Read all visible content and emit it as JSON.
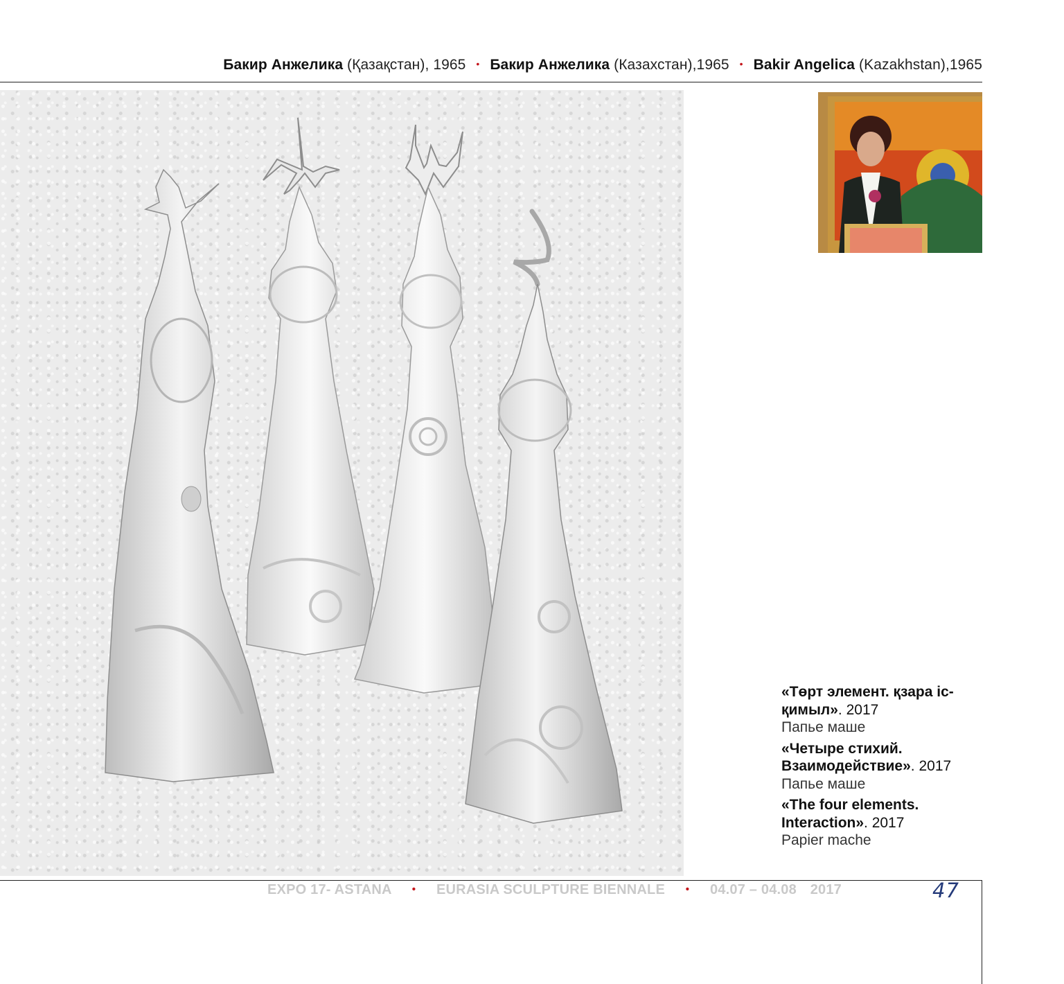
{
  "header": {
    "artist_kk_name": "Бакир Анжелика",
    "artist_kk_meta": "(Қазақстан), 1965",
    "artist_ru_name": "Бакир Анжелика",
    "artist_ru_meta": "(Казахстан),1965",
    "artist_en_name": "Bakir Angelica",
    "artist_en_meta": "(Kazakhstan),1965",
    "separator": "•"
  },
  "captions": [
    {
      "title": "«Төрт элемент. қзара іс-қимыл»",
      "year": "2017",
      "material": "Папье маше"
    },
    {
      "title": "«Четыре стихий. Взаимодействие»",
      "year": "2017",
      "material": "Папье маше"
    },
    {
      "title": "«The four elements. Interaction»",
      "year": "2017",
      "material": "Papier mache"
    }
  ],
  "footer": {
    "expo": "EXPO 17- ASTANA",
    "biennale": "EURASIA SCULPTURE BIENNALE",
    "dates": "04.07 – 04.08",
    "year": "2017",
    "separator": "•",
    "page_number": "47"
  },
  "colors": {
    "accent_red": "#c4161c",
    "page_number_blue": "#243a7a",
    "footer_gray": "#c9c9c9"
  }
}
